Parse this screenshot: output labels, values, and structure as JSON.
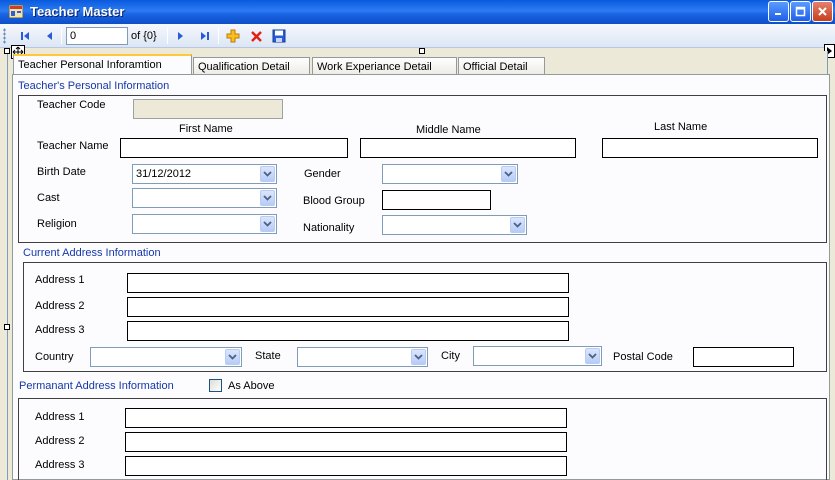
{
  "window": {
    "title": "Teacher Master"
  },
  "toolbar": {
    "position_value": "0",
    "count_label": "of {0}"
  },
  "tabs": [
    {
      "label": "Teacher Personal Inforamtion",
      "active": true
    },
    {
      "label": "Qualification Detail",
      "active": false
    },
    {
      "label": "Work Experiance Detail",
      "active": false
    },
    {
      "label": "Official Detail",
      "active": false
    }
  ],
  "personal": {
    "group_title": "Teacher's Personal Information",
    "teacher_code_label": "Teacher Code",
    "first_name_label": "First Name",
    "middle_name_label": "Middle Name",
    "last_name_label": "Last Name",
    "teacher_name_label": "Teacher Name",
    "birth_date_label": "Birth Date",
    "birth_date_value": "31/12/2012",
    "gender_label": "Gender",
    "cast_label": "Cast",
    "blood_group_label": "Blood Group",
    "religion_label": "Religion",
    "nationality_label": "Nationality"
  },
  "current_address": {
    "group_title": "Current Address Information",
    "address1_label": "Address 1",
    "address2_label": "Address 2",
    "address3_label": "Address 3",
    "country_label": "Country",
    "state_label": "State",
    "city_label": "City",
    "postal_code_label": "Postal Code"
  },
  "permanent_address": {
    "group_title": "Permanant Address Information",
    "as_above_label": "As Above",
    "address1_label": "Address 1",
    "address2_label": "Address 2",
    "address3_label": "Address 3"
  },
  "colors": {
    "group_title": "#1538a8",
    "titlebar": "#0a5ae0",
    "tab_highlight": "#ffc83c"
  }
}
